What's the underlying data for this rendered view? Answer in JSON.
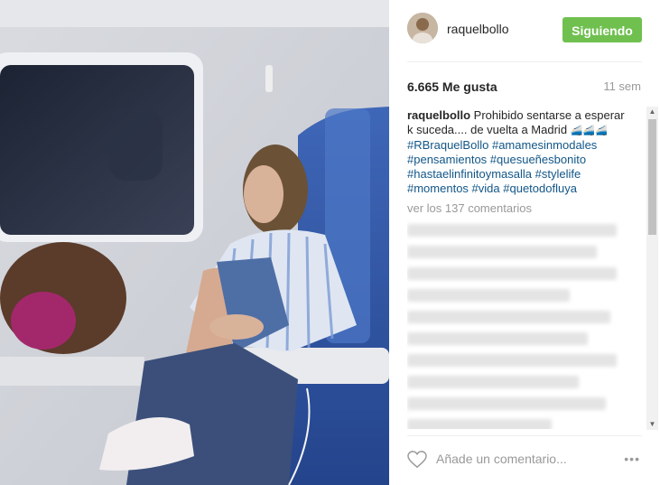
{
  "header": {
    "username": "raquelbollo",
    "follow_label": "Siguiendo"
  },
  "stats": {
    "likes": "6.665 Me gusta",
    "time": "11 sem"
  },
  "caption": {
    "user": "raquelbollo",
    "text": " Prohibido sentarse a esperar k suceda.... de vuelta a Madrid ",
    "emoji": "🚄🚄🚄",
    "tags": [
      "#RBraquelBollo",
      "#amamesinmodales",
      "#pensamientos",
      "#quesueñesbonito",
      "#hastaelinfinitoymasalla",
      "#stylelife",
      "#momentos",
      "#vida",
      "#quetodofluya"
    ]
  },
  "view_more": "ver los 137 comentarios",
  "add_comment_placeholder": "Añade un comentario...",
  "more_icon": "•••",
  "colors": {
    "follow": "#70c050",
    "hashtag": "#125688"
  }
}
